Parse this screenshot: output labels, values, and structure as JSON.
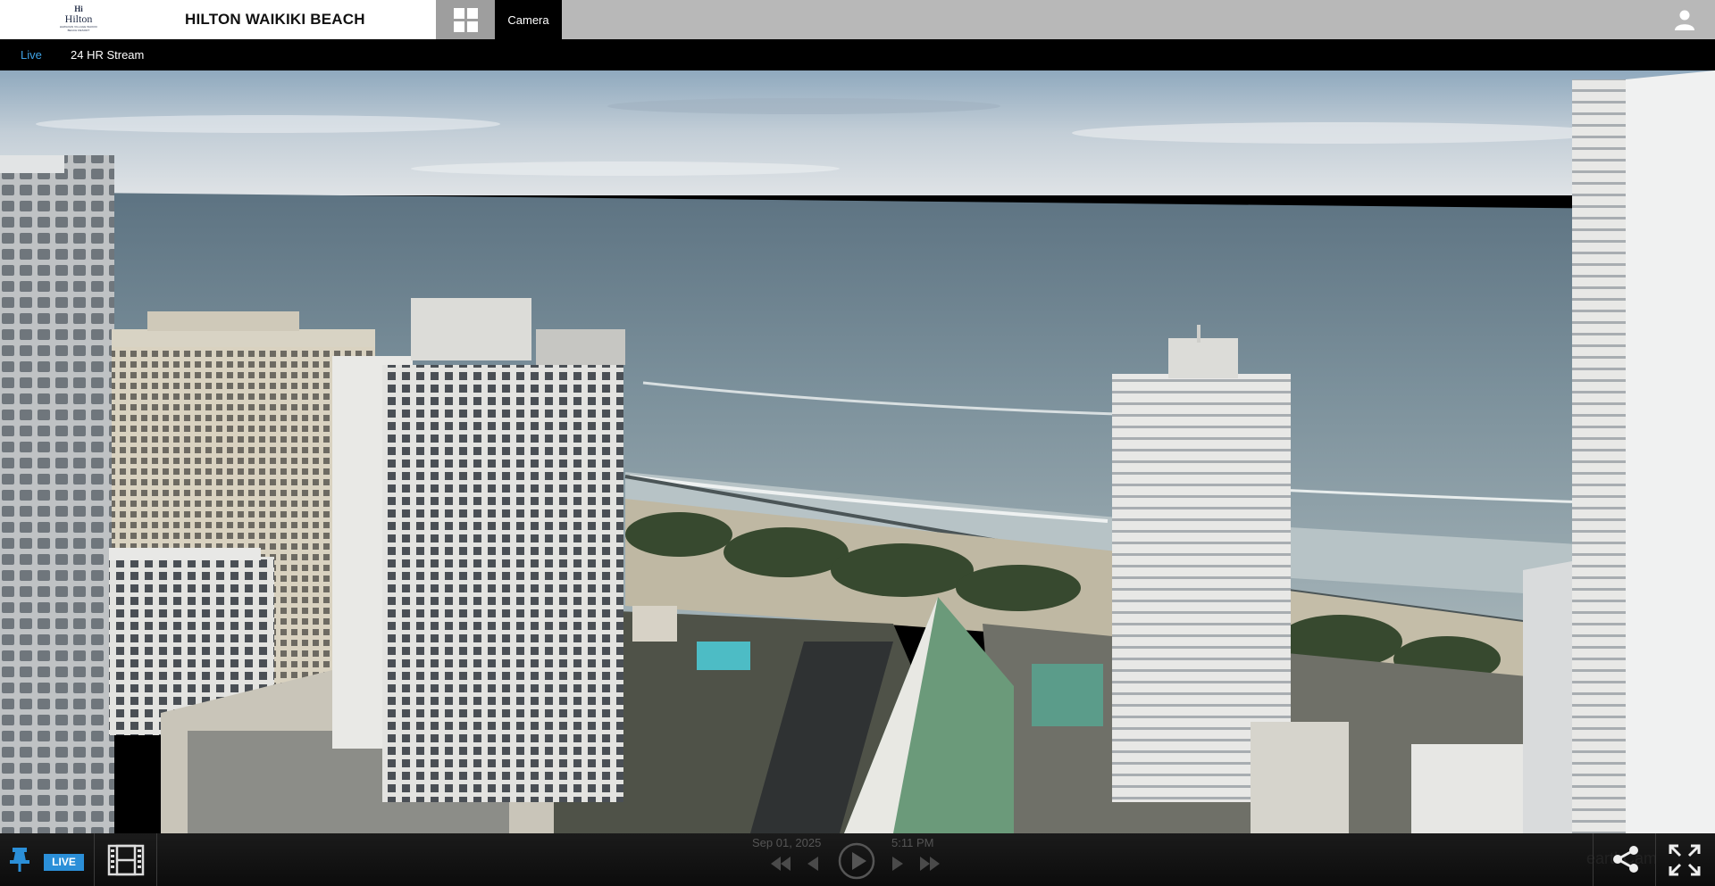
{
  "header": {
    "logo_mark": "Hi",
    "logo_word": "Hilton",
    "logo_tag": "HAWAIIAN VILLAGE WAIKIKI BEACH RESORT",
    "title": "HILTON WAIKIKI BEACH",
    "camera_tab": "Camera"
  },
  "subnav": {
    "live": "Live",
    "stream": "24 HR Stream"
  },
  "controls": {
    "live_badge": "LIVE",
    "date": "Sep 01, 2025",
    "time": "5:11 PM",
    "watermark": "earthCam"
  },
  "colors": {
    "accent": "#3fa3e6",
    "live_badge": "#2b8fd8",
    "header_bg": "#b8b8b8"
  },
  "icons": [
    "hilton-logo",
    "grid-icon",
    "user-icon",
    "pin-icon",
    "film-icon",
    "skip-back-icon",
    "step-back-icon",
    "play-icon",
    "step-forward-icon",
    "skip-forward-icon",
    "share-icon",
    "fullscreen-icon"
  ]
}
